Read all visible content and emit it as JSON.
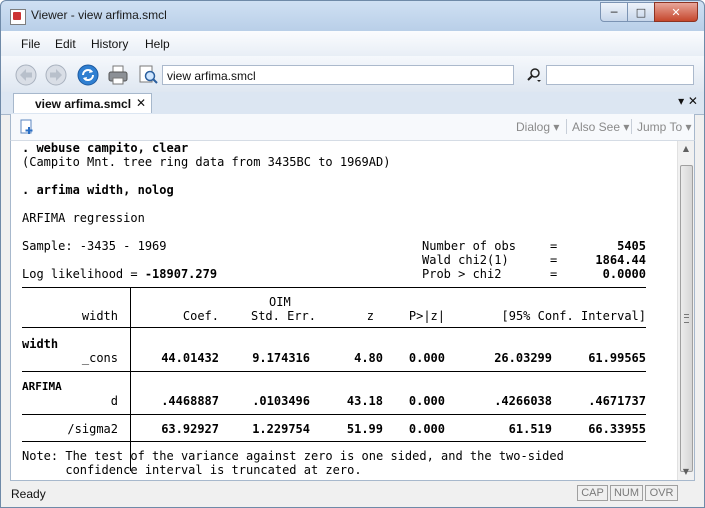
{
  "window": {
    "title": "Viewer - view arfima.smcl"
  },
  "menu": [
    "File",
    "Edit",
    "History",
    "Help"
  ],
  "toolbar": {
    "address_value": "view arfima.smcl",
    "find_value": ""
  },
  "tab": {
    "label": "view arfima.smcl",
    "close": "✕"
  },
  "tabbar_right": "▾ ✕",
  "viewer_toolbar": {
    "dialog": "Dialog ▾",
    "also_see": "Also See ▾",
    "jump_to": "Jump To ▾"
  },
  "output": {
    "cmd1": ". webuse campito, clear",
    "note1": "(Campito Mnt. tree ring data from 3435BC to 1969AD)",
    "cmd2": ". arfima width, nolog",
    "title": "ARFIMA regression",
    "sample_label": "Sample: -3435 - 1969",
    "loglik_label": "Log likelihood = ",
    "loglik_value": "-18907.279",
    "stats": [
      {
        "label": "Number of obs",
        "eq": "=",
        "value": "5405"
      },
      {
        "label": "Wald chi2(1)",
        "eq": "=",
        "value": "1864.44"
      },
      {
        "label": "Prob > chi2",
        "eq": "=",
        "value": "0.0000"
      }
    ],
    "table": {
      "depvar": "width",
      "header_top": "OIM",
      "headers": [
        "Coef.",
        "Std. Err.",
        "z",
        "P>|z|",
        "[95% Conf. Interval]"
      ],
      "groups": [
        {
          "name": "width",
          "rows": [
            {
              "label": "_cons",
              "coef": "44.01432",
              "se": "9.174316",
              "z": "4.80",
              "p": "0.000",
              "lo": "26.03299",
              "hi": "61.99565"
            }
          ]
        },
        {
          "name": "ARFIMA",
          "rows": [
            {
              "label": "d",
              "coef": ".4468887",
              "se": ".0103496",
              "z": "43.18",
              "p": "0.000",
              "lo": ".4266038",
              "hi": ".4671737"
            }
          ]
        }
      ],
      "sigma": {
        "label": "/sigma2",
        "coef": "63.92927",
        "se": "1.229754",
        "z": "51.99",
        "p": "0.000",
        "lo": "61.519",
        "hi": "66.33955"
      }
    },
    "note_line1": "Note: The test of the variance against zero is one sided, and the two-sided",
    "note_line2": "      confidence interval is truncated at zero."
  },
  "status": {
    "text": "Ready",
    "indicators": [
      "CAP",
      "NUM",
      "OVR"
    ]
  },
  "colors": {
    "title_bg": "#cfe0f3",
    "content_bg": "#ffffff",
    "link_gray": "#8a8a8a"
  }
}
